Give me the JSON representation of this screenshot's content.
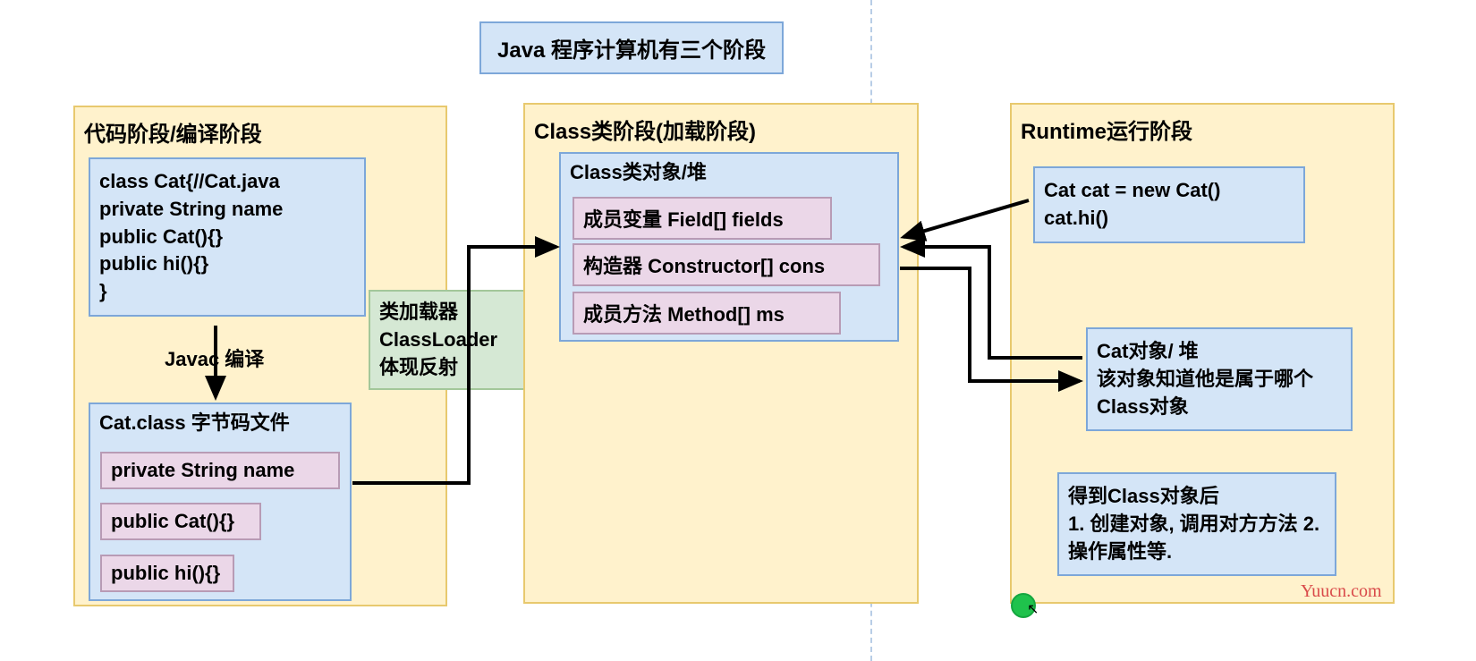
{
  "title": "Java 程序计算机有三个阶段",
  "stage1": {
    "title": "代码阶段/编译阶段",
    "code": "class Cat{//Cat.java\nprivate String name\npublic Cat(){}\npublic hi(){}\n}",
    "compileLabel": "Javac 编译",
    "bytecodeTitle": "Cat.class 字节码文件",
    "bytecode1": "private String name",
    "bytecode2": "public Cat(){}",
    "bytecode3": "public hi(){}"
  },
  "loader": "类加载器\nClassLoader\n体现反射",
  "stage2": {
    "title": "Class类阶段(加载阶段)",
    "heapTitle": "Class类对象/堆",
    "field": "成员变量 Field[] fields",
    "constructor": "构造器 Constructor[] cons",
    "method": "成员方法 Method[] ms"
  },
  "stage3": {
    "title": "Runtime运行阶段",
    "code": "Cat cat = new Cat()\ncat.hi()",
    "objInfo": "Cat对象/ 堆\n该对象知道他是属于哪个Class对象",
    "afterClass": "得到Class对象后\n1. 创建对象, 调用对方方法 2. 操作属性等."
  },
  "watermark": "Yuucn.com"
}
